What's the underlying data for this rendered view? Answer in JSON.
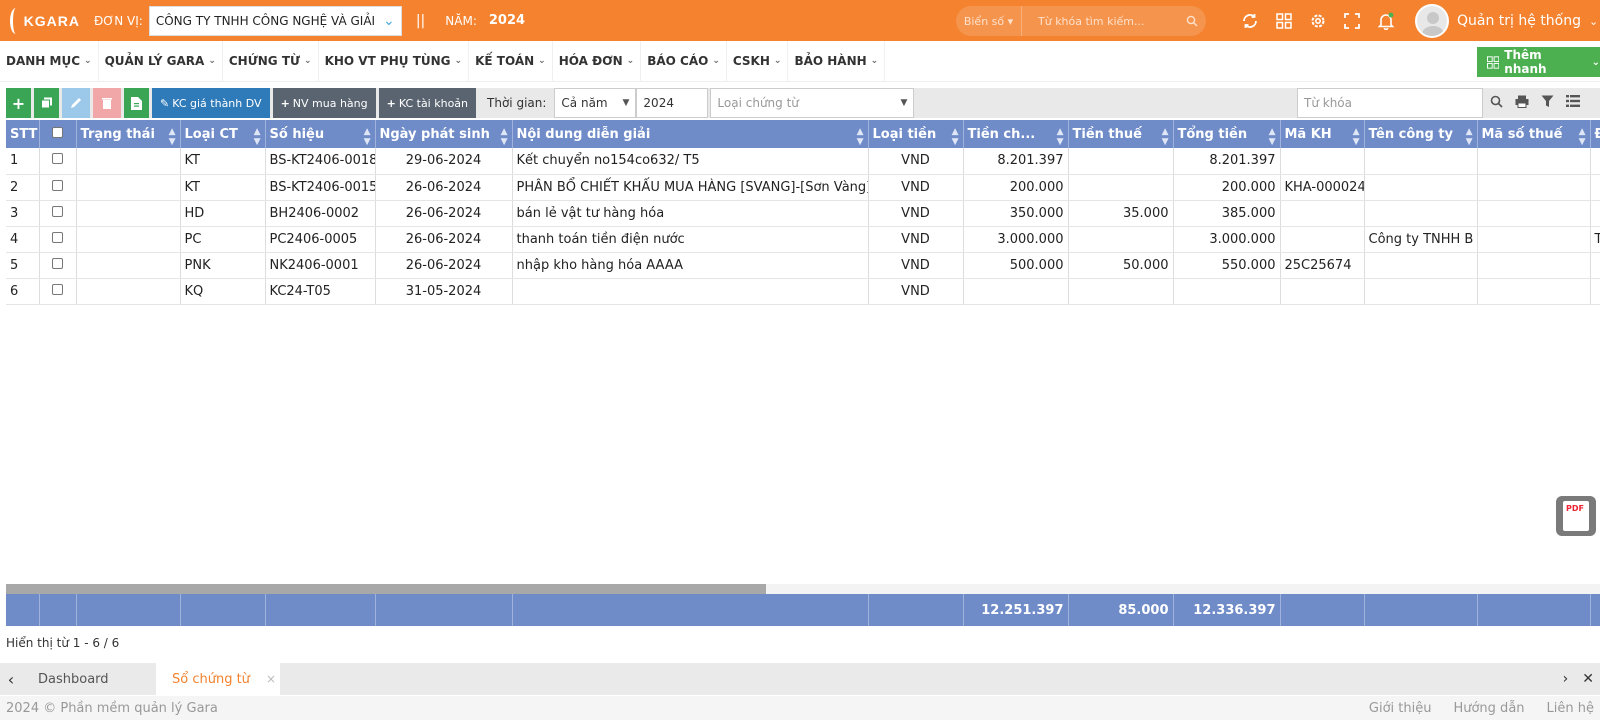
{
  "header": {
    "logo_text": "KGARA",
    "unit_label": "ĐƠN VỊ:",
    "unit_value": "CÔNG TY TNHH CÔNG NGHỆ VÀ GIẢI",
    "separator": "||",
    "year_label": "NĂM:",
    "year_value": "2024",
    "plate_select": "Biển số",
    "search_placeholder": "Từ khóa tìm kiếm...",
    "user_name": "Quản trị hệ thống",
    "accent_color": "#f4822e"
  },
  "menu": {
    "items": [
      "DANH MỤC",
      "QUẢN LÝ GARA",
      "CHỨNG TỪ",
      "KHO VT PHỤ TÙNG",
      "KẾ TOÁN",
      "HÓA ĐƠN",
      "BÁO CÁO",
      "CSKH",
      "BẢO HÀNH"
    ],
    "quick_add": "Thêm nhanh"
  },
  "toolbar": {
    "kc_cost_label": "KC giá thành DV",
    "nv_purchase_label": "NV mua hàng",
    "kc_account_label": "KC tài khoản",
    "time_label": "Thời gian:",
    "period_value": "Cả năm",
    "year_input": "2024",
    "doc_type_placeholder": "Loại chứng từ",
    "keyword_placeholder": "Từ khóa"
  },
  "table": {
    "columns": [
      "STT",
      "",
      "Trạng thái",
      "Loại CT",
      "Số hiệu",
      "Ngày phát sinh",
      "Nội dung diễn giải",
      "Loại tiền",
      "Tiền ch...",
      "Tiền thuế",
      "Tổng tiền",
      "Mã KH",
      "Tên công ty",
      "Mã số thuế",
      "Đ"
    ],
    "rows": [
      {
        "stt": "1",
        "status": "",
        "type": "KT",
        "code": "BS-KT2406-0018",
        "date": "29-06-2024",
        "desc": "Kết chuyển no154co632/ T5",
        "currency": "VND",
        "amount": "8.201.397",
        "tax": "",
        "total": "8.201.397",
        "customer": "",
        "company": "",
        "taxcode": "",
        "extra": ""
      },
      {
        "stt": "2",
        "status": "",
        "type": "KT",
        "code": "BS-KT2406-0015",
        "date": "26-06-2024",
        "desc": "PHÂN BỔ CHIẾT KHẤU MUA HÀNG [SVANG]-[Sơn Vàng]",
        "currency": "VND",
        "amount": "200.000",
        "tax": "",
        "total": "200.000",
        "customer": "KHA-000024",
        "company": "",
        "taxcode": "",
        "extra": ""
      },
      {
        "stt": "3",
        "status": "",
        "type": "HD",
        "code": "BH2406-0002",
        "date": "26-06-2024",
        "desc": "bán lẻ vật tư hàng hóa",
        "currency": "VND",
        "amount": "350.000",
        "tax": "35.000",
        "total": "385.000",
        "customer": "",
        "company": "",
        "taxcode": "",
        "extra": ""
      },
      {
        "stt": "4",
        "status": "",
        "type": "PC",
        "code": "PC2406-0005",
        "date": "26-06-2024",
        "desc": "thanh toán tiền điện nước",
        "currency": "VND",
        "amount": "3.000.000",
        "tax": "",
        "total": "3.000.000",
        "customer": "",
        "company": "Công ty TNHH B",
        "taxcode": "",
        "extra": "Th"
      },
      {
        "stt": "5",
        "status": "",
        "type": "PNK",
        "code": "NK2406-0001",
        "date": "26-06-2024",
        "desc": "nhập kho hàng hóa AAAA",
        "currency": "VND",
        "amount": "500.000",
        "tax": "50.000",
        "total": "550.000",
        "customer": "25C25674",
        "company": "",
        "taxcode": "",
        "extra": ""
      },
      {
        "stt": "6",
        "status": "",
        "type": "KQ",
        "code": "KC24-T05",
        "date": "31-05-2024",
        "desc": "",
        "currency": "VND",
        "amount": "",
        "tax": "",
        "total": "",
        "customer": "",
        "company": "",
        "taxcode": "",
        "extra": ""
      }
    ],
    "totals": {
      "amount": "12.251.397",
      "tax": "85.000",
      "total": "12.336.397"
    },
    "header_color": "#6f8cc9"
  },
  "paging": "Hiển thị từ 1 - 6 / 6",
  "tabs": {
    "items": [
      "Dashboard",
      "Sổ chứng từ"
    ],
    "active_close": "×"
  },
  "footer": {
    "copyright": "2024 © Phần mềm quản lý Gara",
    "links": [
      "Giới thiệu",
      "Hướng dẫn",
      "Liên hệ"
    ]
  },
  "pdf_badge": "PDF"
}
